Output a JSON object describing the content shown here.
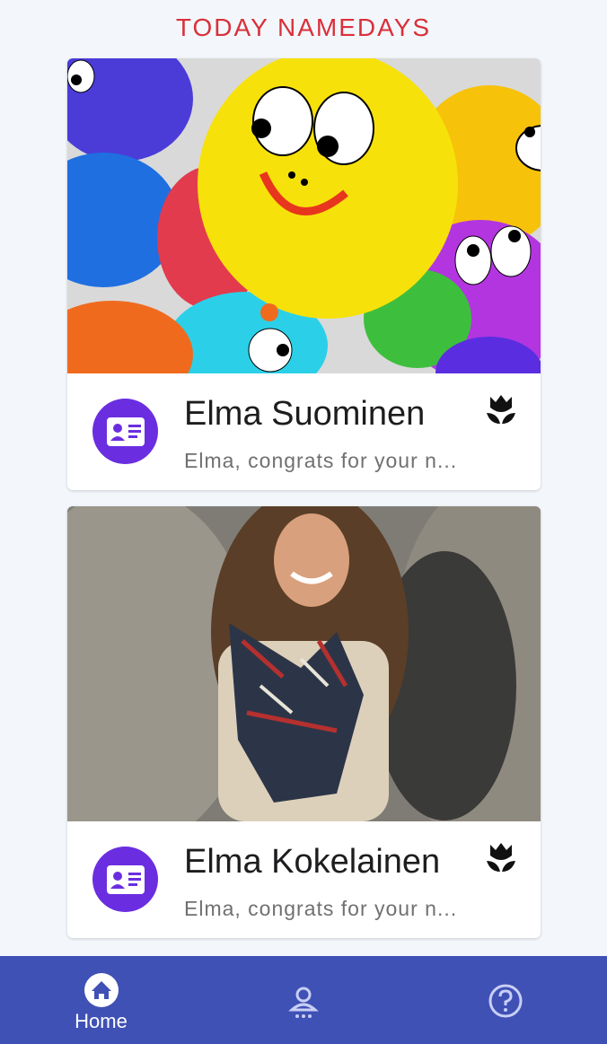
{
  "header": {
    "title": "TODAY NAMEDAYS"
  },
  "cards": [
    {
      "image_alt": "Colorful cartoon balloons with faces",
      "avatar_icon": "id-card-icon",
      "name": "Elma Suominen",
      "message": "Elma, congrats for your n...",
      "action_icon": "tulip-icon"
    },
    {
      "image_alt": "Smiling woman with long hair and plaid scarf",
      "avatar_icon": "id-card-icon",
      "name": "Elma Kokelainen",
      "message": "Elma, congrats for your n...",
      "action_icon": "tulip-icon"
    }
  ],
  "navbar": {
    "items": [
      {
        "label": "Home",
        "icon": "home-icon",
        "active": true
      },
      {
        "label": "",
        "icon": "profile-icon",
        "active": false
      },
      {
        "label": "",
        "icon": "help-icon",
        "active": false
      }
    ]
  },
  "colors": {
    "title": "#d9303a",
    "avatar": "#6a2ee0",
    "navbar": "#3f51b5",
    "background": "#f3f7fb"
  }
}
